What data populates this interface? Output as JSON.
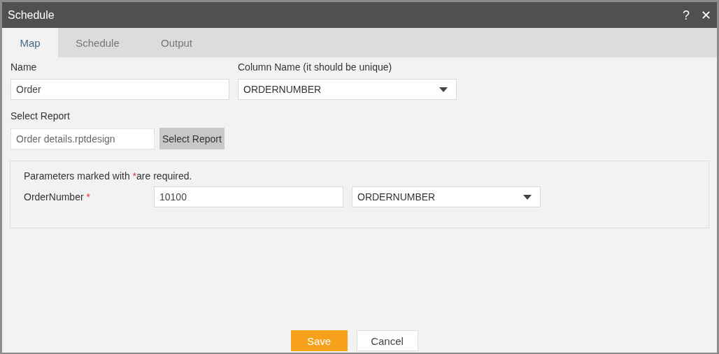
{
  "window": {
    "title": "Schedule",
    "help": "?",
    "close": "✕"
  },
  "tabs": [
    {
      "label": "Map",
      "selected": true
    },
    {
      "label": "Schedule",
      "selected": false
    },
    {
      "label": "Output",
      "selected": false
    }
  ],
  "name_field": {
    "label": "Name",
    "value": "Order"
  },
  "column_field": {
    "label": "Column Name (it should be unique)",
    "value": "ORDERNUMBER"
  },
  "report": {
    "label": "Select Report",
    "value": "Order details.rptdesign",
    "button": "Select Report"
  },
  "parameters": {
    "note": {
      "before": "Parameters marked with",
      "mark": "*",
      "after": "are required."
    },
    "rows": [
      {
        "label": "OrderNumber",
        "required_mark": "*",
        "value": "10100",
        "column": "ORDERNUMBER"
      }
    ]
  },
  "buttons": [
    {
      "label": "Save",
      "kind": "primary"
    },
    {
      "label": "Cancel",
      "kind": "secondary"
    }
  ]
}
